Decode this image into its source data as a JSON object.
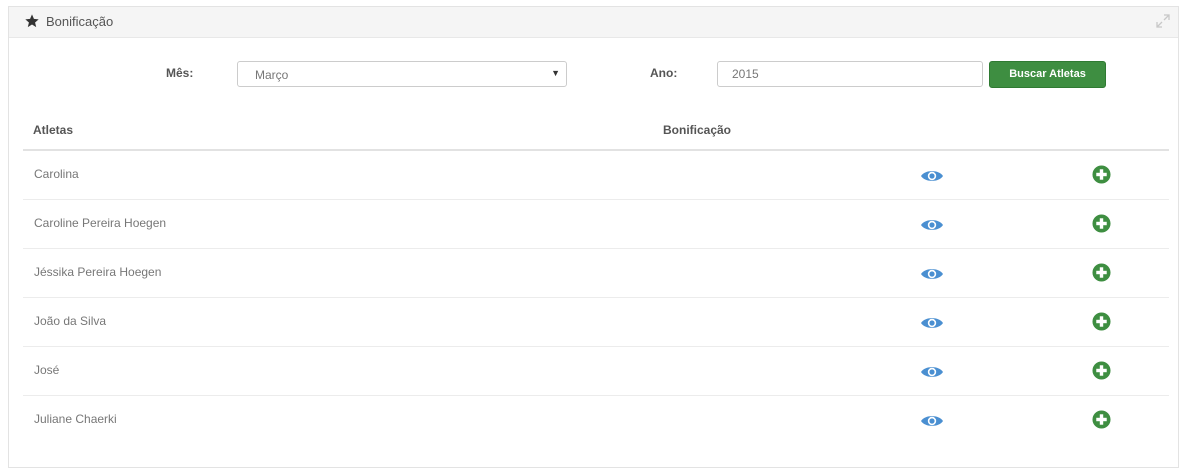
{
  "panel": {
    "title": "Bonificação",
    "icon": "star-icon",
    "expand_icon": "expand-icon"
  },
  "filters": {
    "month_label": "Mês:",
    "month_value": "Março",
    "year_label": "Ano:",
    "year_value": "2015",
    "search_button": "Buscar Atletas"
  },
  "table": {
    "headers": [
      "Atletas",
      "Bonificação"
    ],
    "rows": [
      {
        "name": "Carolina"
      },
      {
        "name": "Caroline Pereira Hoegen"
      },
      {
        "name": "Jéssika Pereira Hoegen"
      },
      {
        "name": "João da Silva"
      },
      {
        "name": "José"
      },
      {
        "name": "Juliane Chaerki"
      }
    ],
    "row_icons": [
      "eye-icon",
      "plus-circle-icon"
    ]
  },
  "colors": {
    "primary_green": "#3e8e41",
    "eye_blue": "#4a8fd1",
    "header_bg": "#f5f5f5"
  }
}
